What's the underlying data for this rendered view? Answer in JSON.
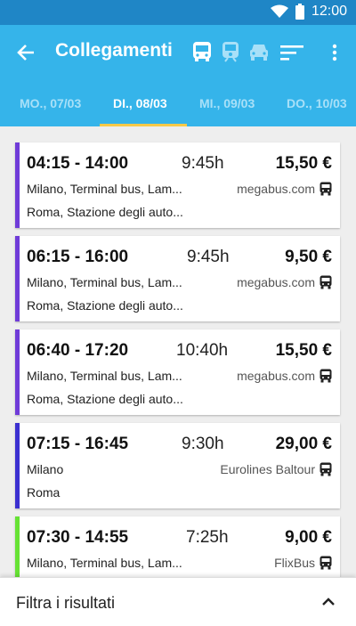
{
  "status_bar": {
    "time": "12:00",
    "icons": [
      "wifi-icon",
      "battery-icon"
    ]
  },
  "app_bar": {
    "title": "Collegamenti",
    "back_icon": "arrow-left-icon",
    "transport_modes": [
      "bus-icon",
      "train-icon",
      "car-icon"
    ],
    "sort_icon": "sort-icon",
    "more_icon": "more-vertical-icon"
  },
  "tabs": [
    {
      "label": "MO., 07/03",
      "active": false
    },
    {
      "label": "DI., 08/03",
      "active": true
    },
    {
      "label": "MI., 09/03",
      "active": false
    },
    {
      "label": "DO., 10/03",
      "active": false
    }
  ],
  "trips": [
    {
      "time": "04:15 - 14:00",
      "duration": "9:45h",
      "price": "15,50 €",
      "origin": "Milano, Terminal bus, Lam...",
      "destination": "Roma, Stazione degli auto...",
      "carrier": "megabus.com",
      "accent": "#6f3bd8"
    },
    {
      "time": "06:15 - 16:00",
      "duration": "9:45h",
      "price": "9,50 €",
      "origin": "Milano, Terminal bus, Lam...",
      "destination": "Roma, Stazione degli auto...",
      "carrier": "megabus.com",
      "accent": "#6f3bd8"
    },
    {
      "time": "06:40 - 17:20",
      "duration": "10:40h",
      "price": "15,50 €",
      "origin": "Milano, Terminal bus, Lam...",
      "destination": "Roma, Stazione degli auto...",
      "carrier": "megabus.com",
      "accent": "#6f3bd8"
    },
    {
      "time": "07:15 - 16:45",
      "duration": "9:30h",
      "price": "29,00 €",
      "origin": "Milano",
      "destination": "Roma",
      "carrier": "Eurolines Baltour",
      "accent": "#3b2fd0"
    },
    {
      "time": "07:30 - 14:55",
      "duration": "7:25h",
      "price": "9,00 €",
      "origin": "Milano, Terminal bus, Lam...",
      "destination": "",
      "carrier": "FlixBus",
      "accent": "#66e234"
    }
  ],
  "filter_bar": {
    "label": "Filtra i risultati",
    "icon": "chevron-up-icon"
  },
  "colors": {
    "primary": "#35b4ea",
    "status_bar": "#1f86c6",
    "tab_indicator": "#f7c948"
  }
}
